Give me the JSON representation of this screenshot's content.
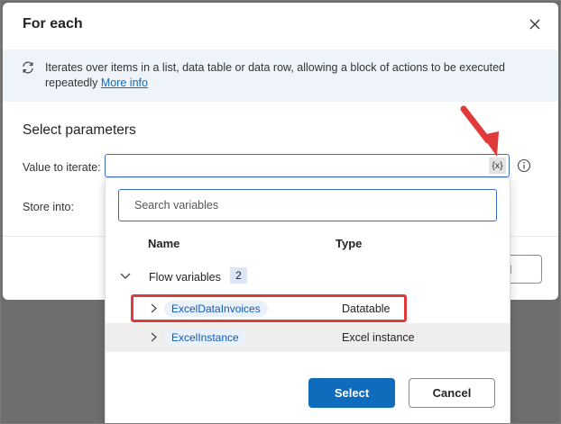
{
  "dialog": {
    "title": "For each",
    "info_text": "Iterates over items in a list, data table or data row, allowing a block of actions to be executed repeatedly",
    "info_link": "More info",
    "section_title": "Select parameters",
    "value_label": "Value to iterate:",
    "value": "",
    "var_button": "{x}",
    "store_label": "Store into:",
    "bg_cancel_label": "el"
  },
  "popup": {
    "search_placeholder": "Search variables",
    "columns": {
      "name": "Name",
      "type": "Type"
    },
    "group": {
      "label": "Flow variables",
      "count": "2"
    },
    "rows": [
      {
        "name": "ExcelDataInvoices",
        "type": "Datatable"
      },
      {
        "name": "ExcelInstance",
        "type": "Excel instance"
      }
    ],
    "select_label": "Select",
    "cancel_label": "Cancel"
  },
  "colors": {
    "accent": "#0f6cbd",
    "annotation_red": "#e03a3a",
    "banner_bg": "#eff4fb",
    "pill_bg": "#eaf1fb"
  },
  "icons": [
    "close-icon",
    "loop-icon",
    "info-icon",
    "chevron-down-icon",
    "chevron-right-icon",
    "arrow-annotation"
  ]
}
